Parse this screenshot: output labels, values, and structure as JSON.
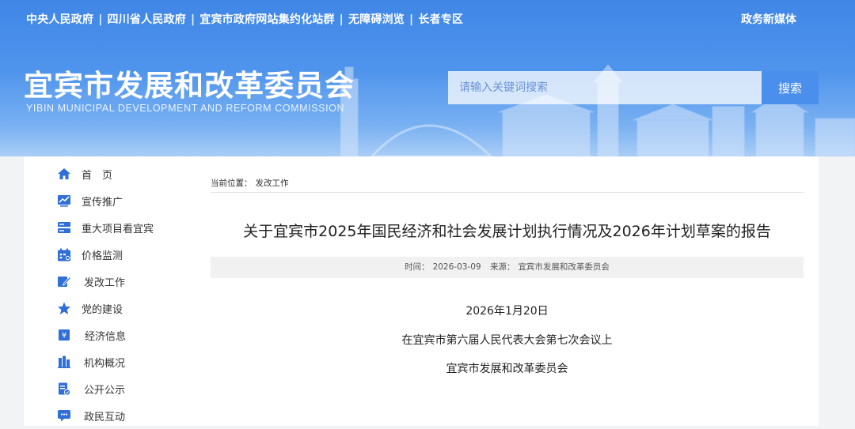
{
  "header": {
    "top_links": [
      "中央人民政府",
      "四川省人民政府",
      "宜宾市政府网站集约化站群",
      "无障碍浏览",
      "长者专区"
    ],
    "top_separator": "|",
    "media_link": "政务新媒体",
    "site_title": "宜宾市发展和改革委员会",
    "site_subtitle": "YIBIN MUNICIPAL DEVELOPMENT AND REFORM COMMISSION",
    "search_placeholder": "请输入关键词搜索",
    "search_button": "搜索"
  },
  "sidebar": {
    "items": [
      {
        "label": "首　页",
        "icon": "home-icon"
      },
      {
        "label": "宣传推广",
        "icon": "chart-icon"
      },
      {
        "label": "重大项目看宜宾",
        "icon": "server-icon"
      },
      {
        "label": "价格监测",
        "icon": "calendar-icon"
      },
      {
        "label": "发改工作",
        "icon": "edit-icon"
      },
      {
        "label": "党的建设",
        "icon": "star-icon"
      },
      {
        "label": "经济信息",
        "icon": "yuan-icon"
      },
      {
        "label": "机构概况",
        "icon": "building-icon"
      },
      {
        "label": "公开公示",
        "icon": "document-icon"
      },
      {
        "label": "政民互动",
        "icon": "chat-icon"
      }
    ]
  },
  "breadcrumb": {
    "prefix": "当前位置：",
    "current": "发改工作"
  },
  "article": {
    "title": "关于宜宾市2025年国民经济和社会发展计划执行情况及2026年计划草案的报告",
    "meta_time_label": "时间：",
    "meta_time": "2026-03-09",
    "meta_source_label": "来源：",
    "meta_source": "宜宾市发展和改革委员会",
    "paragraphs": [
      "2026年1月20日",
      "在宜宾市第六届人民代表大会第七次会议上",
      "宜宾市发展和改革委员会"
    ]
  },
  "colors": {
    "banner_top": "#3f86e6",
    "banner_bottom": "#a9cdf6",
    "icon_blue": "#2f6fd6",
    "search_button": "#4b8fec"
  }
}
